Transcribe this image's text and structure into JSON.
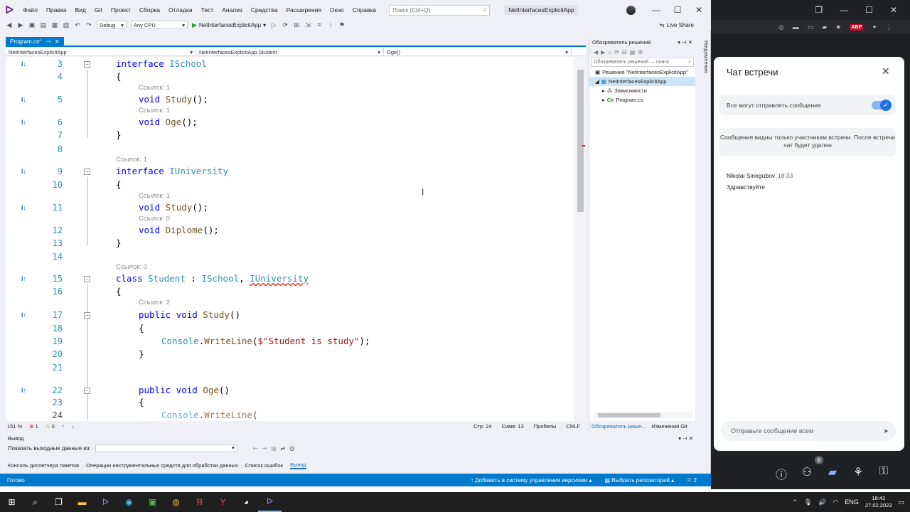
{
  "vs": {
    "menu": [
      "Файл",
      "Правка",
      "Вид",
      "Git",
      "Проект",
      "Сборка",
      "Отладка",
      "Тест",
      "Анализ",
      "Средства",
      "Расширения",
      "Окно",
      "Справка"
    ],
    "search_placeholder": "Поиск (Ctrl+Q)",
    "solution_title": "NetInterfacesExplicitApp",
    "toolbar": {
      "config": "Debug",
      "platform": "Any CPU",
      "run_target": "NetInterfacesExplicitApp",
      "live_share": "Live Share"
    },
    "doc_tab": "Program.cs*",
    "nav": {
      "project": "NetInterfacesExplicitApp",
      "class": "NetInterfacesExplicitApp.Student",
      "member": "Oge()"
    },
    "code": {
      "lines": [
        {
          "n": "3",
          "icon": "I↓",
          "lens": ""
        },
        {
          "n": "4",
          "icon": "",
          "lens": ""
        },
        {
          "n": "5",
          "icon": "I↓",
          "lens": "Ссылок: 1"
        },
        {
          "n": "6",
          "icon": "I↓",
          "lens": "Ссылок: 1"
        },
        {
          "n": "7",
          "icon": "",
          "lens": ""
        },
        {
          "n": "8",
          "icon": "",
          "lens": ""
        },
        {
          "n": "9",
          "icon": "I↓",
          "lens": "Ссылок: 1"
        },
        {
          "n": "10",
          "icon": "",
          "lens": ""
        },
        {
          "n": "11",
          "icon": "I↓",
          "lens": "Ссылок: 1"
        },
        {
          "n": "12",
          "icon": "",
          "lens": "Ссылок: 0"
        },
        {
          "n": "13",
          "icon": "",
          "lens": ""
        },
        {
          "n": "14",
          "icon": "",
          "lens": ""
        },
        {
          "n": "15",
          "icon": "I↑",
          "lens": "Ссылок: 0"
        },
        {
          "n": "16",
          "icon": "",
          "lens": ""
        },
        {
          "n": "17",
          "icon": "I↑",
          "lens": "Ссылок: 2"
        },
        {
          "n": "18",
          "icon": "",
          "lens": ""
        },
        {
          "n": "19",
          "icon": "",
          "lens": ""
        },
        {
          "n": "20",
          "icon": "",
          "lens": ""
        },
        {
          "n": "21",
          "icon": "",
          "lens": ""
        },
        {
          "n": "22",
          "icon": "I↑",
          "lens": ""
        },
        {
          "n": "23",
          "icon": "",
          "lens": ""
        },
        {
          "n": "24",
          "icon": "",
          "lens": ""
        }
      ],
      "text": {
        "l3_kw": "interface",
        "l3_name": "ISchool",
        "l4": "{",
        "l5_kw": "void",
        "l5_m": "Study",
        "l5_rest": "();",
        "l6_kw": "void",
        "l6_m": "Oge",
        "l6_rest": "();",
        "l7": "}",
        "l9_kw": "interface",
        "l9_name": "IUniversity",
        "l10": "{",
        "l11_kw": "void",
        "l11_m": "Study",
        "l11_rest": "();",
        "l12_kw": "void",
        "l12_m": "Diplome",
        "l12_rest": "();",
        "l13": "}",
        "l15_kw": "class",
        "l15_name": "Student",
        "l15_sep": " : ",
        "l15_i1": "ISchool",
        "l15_comma": ", ",
        "l15_i2": "IUniversity",
        "l16": "{",
        "l17_kw": "public void",
        "l17_m": "Study",
        "l17_rest": "()",
        "l18": "{",
        "l19_ty": "Console",
        "l19_dot": ".",
        "l19_m": "WriteLine",
        "l19_open": "(",
        "l19_str": "$\"Student is study\"",
        "l19_close": ");",
        "l20": "}",
        "l22_kw": "public void",
        "l22_m": "Oge",
        "l22_rest": "()",
        "l23": "{",
        "l24_ty": "Console",
        "l24_dot": ".",
        "l24_m": "WriteLine",
        "l24_open": "("
      }
    },
    "status": {
      "zoom": "151 %",
      "errors": "1",
      "warnings": "0",
      "line": "Стр: 24",
      "col": "Симв: 13",
      "space": "Пробелы",
      "crlf": "CRLF"
    },
    "solution_explorer": {
      "title": "Обозреватель решений",
      "search": "Обозреватель решений — поиск",
      "items": [
        "Решение \"NetInterfacesExplicitApp\"",
        "NetInterfacesExplicitApp",
        "Зависимости",
        "Program.cs"
      ],
      "bottom_tabs": [
        "Обозреватель реше...",
        "Изменения Git"
      ],
      "vertical_tab": "Уведомления"
    },
    "output": {
      "title": "Вывод",
      "show_from": "Показать выходные данные из:",
      "tabs": [
        "Консоль диспетчера пакетов",
        "Операции инструментальных средств для обработки данных",
        "Список ошибок",
        "Вывод"
      ]
    },
    "statusbar": {
      "ready": "Готово",
      "add_vcs": "Добавить в систему управления версиями",
      "select_repo": "Выбрать репозиторий",
      "notif_count": "2"
    }
  },
  "chat": {
    "title": "Чат встречи",
    "toggle_label": "Все могут отправлять сообщения",
    "notice": "Сообщения видны только участникам встречи. После встречи чат будет удален",
    "message": {
      "author": "Nikolai Sinegubov",
      "time": "18:33",
      "text": "Здравствуйте"
    },
    "input_placeholder": "Отправьте сообщение всем",
    "participants_badge": "8"
  },
  "taskbar": {
    "lang": "ENG",
    "time": "18:43",
    "date": "27.02.2023"
  }
}
